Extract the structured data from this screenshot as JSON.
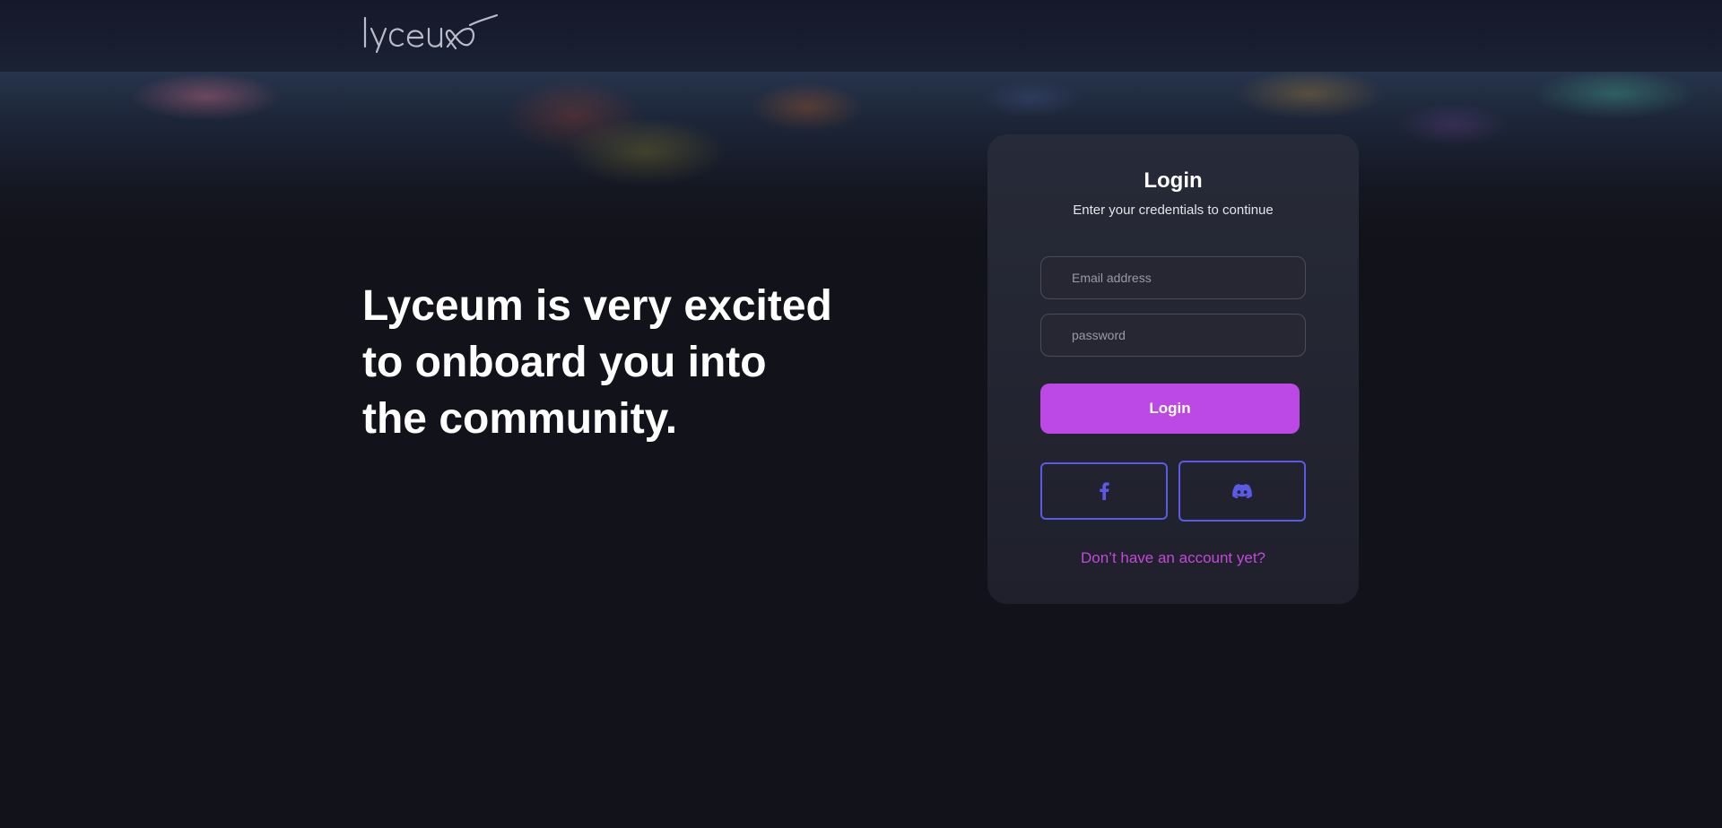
{
  "header": {
    "logo_text": "lyceum"
  },
  "hero": {
    "headline_line1": "Lyceum is very excited",
    "headline_line2": "to onboard you into",
    "headline_line3": "the community."
  },
  "login": {
    "title": "Login",
    "subtitle": "Enter your credentials to continue",
    "email_placeholder": "Email address",
    "password_placeholder": "password",
    "login_button": "Login",
    "social": [
      "facebook-icon",
      "discord-icon"
    ],
    "signup_link": "Don’t have an account yet?"
  },
  "colors": {
    "accent": "#bc48e6",
    "link": "#c14ad9",
    "social_border": "#5a5ae6",
    "background": "#12121a",
    "card": "#272a38"
  }
}
